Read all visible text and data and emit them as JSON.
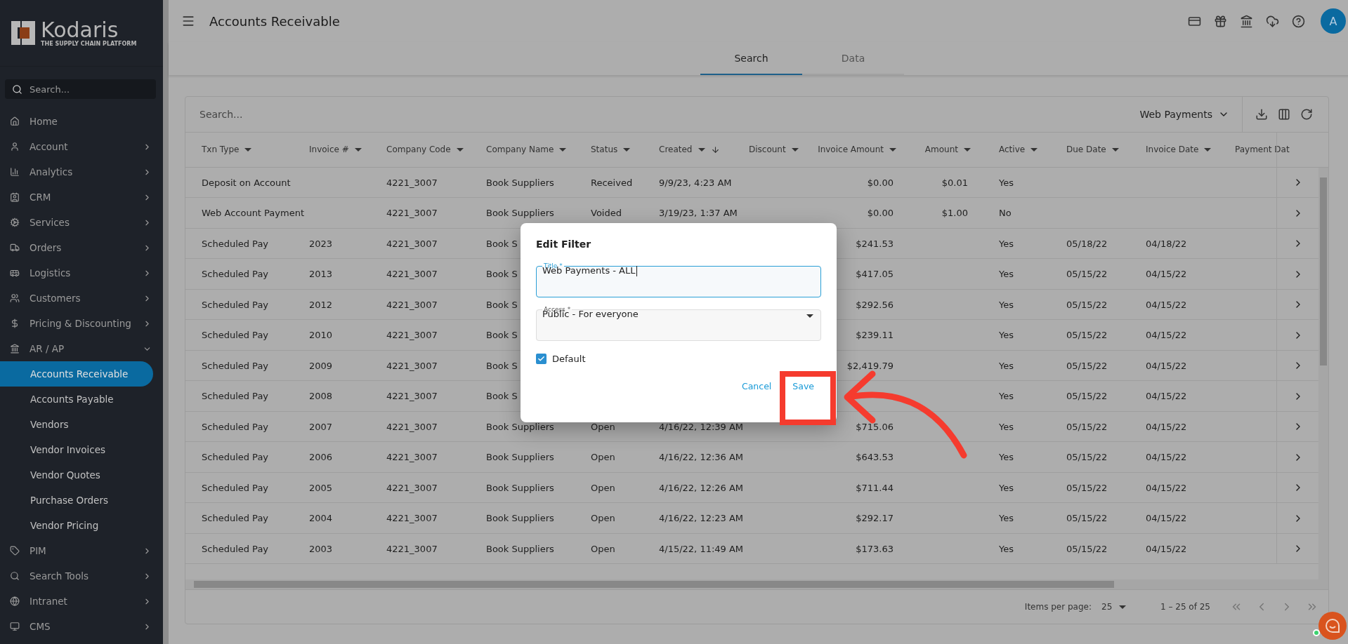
{
  "sidebar": {
    "logo": {
      "name": "Kodaris",
      "tagline": "THE SUPPLY CHAIN PLATFORM"
    },
    "search": {
      "placeholder": "Search..."
    },
    "items": [
      {
        "label": "Home"
      },
      {
        "label": "Account",
        "expanded": false
      },
      {
        "label": "Analytics",
        "expanded": false
      },
      {
        "label": "CRM",
        "expanded": false
      },
      {
        "label": "Services",
        "expanded": false
      },
      {
        "label": "Orders",
        "expanded": false
      },
      {
        "label": "Logistics",
        "expanded": false
      },
      {
        "label": "Customers",
        "expanded": false
      },
      {
        "label": "Pricing & Discounting",
        "expanded": false
      },
      {
        "label": "AR / AP",
        "expanded": true,
        "children": [
          {
            "label": "Accounts Receivable",
            "selected": true
          },
          {
            "label": "Accounts Payable",
            "selected": false
          },
          {
            "label": "Vendors",
            "selected": false
          },
          {
            "label": "Vendor Invoices",
            "selected": false
          },
          {
            "label": "Vendor Quotes",
            "selected": false
          },
          {
            "label": "Purchase Orders",
            "selected": false
          },
          {
            "label": "Vendor Pricing",
            "selected": false
          }
        ]
      },
      {
        "label": "PIM",
        "expanded": false
      },
      {
        "label": "Search Tools",
        "expanded": false
      },
      {
        "label": "Intranet",
        "expanded": false
      },
      {
        "label": "CMS",
        "expanded": false
      }
    ]
  },
  "header": {
    "title": "Accounts Receivable",
    "avatar": "A"
  },
  "tabs": [
    {
      "label": "Search",
      "selected": true
    },
    {
      "label": "Data",
      "selected": false
    }
  ],
  "table": {
    "search": {
      "placeholder": "Search..."
    },
    "filter": "Web Payments",
    "columns": [
      {
        "label": "Txn Type",
        "sorted": false
      },
      {
        "label": "Invoice #",
        "sorted": false
      },
      {
        "label": "Company Code",
        "sorted": false
      },
      {
        "label": "Company Name",
        "sorted": false
      },
      {
        "label": "Status",
        "sorted": false
      },
      {
        "label": "Created",
        "sorted": true
      },
      {
        "label": "Discount",
        "sorted": false
      },
      {
        "label": "Invoice Amount",
        "sorted": false
      },
      {
        "label": "Amount",
        "sorted": false
      },
      {
        "label": "Active",
        "sorted": false
      },
      {
        "label": "Due Date",
        "sorted": false
      },
      {
        "label": "Invoice Date",
        "sorted": false
      },
      {
        "label": "Payment Dat",
        "sorted": false
      }
    ],
    "rows": [
      [
        "Deposit on Account",
        null,
        "4221_3007",
        "Book Suppliers",
        "Received",
        "9/9/23, 4:23 AM",
        null,
        "$0.00",
        "$0.01",
        "Yes",
        null,
        null
      ],
      [
        "Web Account Payment",
        null,
        "4221_3007",
        "Book Suppliers",
        "Voided",
        "3/19/23, 1:37 AM",
        null,
        "$0.00",
        "$1.00",
        "No",
        null,
        null
      ],
      [
        "Scheduled Pay",
        "2023",
        "4221_3007",
        "Book S",
        null,
        null,
        null,
        "$241.53",
        null,
        "Yes",
        "05/18/22",
        "04/18/22"
      ],
      [
        "Scheduled Pay",
        "2013",
        "4221_3007",
        "Book S",
        null,
        null,
        null,
        "$417.05",
        null,
        "Yes",
        "05/15/22",
        "04/15/22"
      ],
      [
        "Scheduled Pay",
        "2012",
        "4221_3007",
        "Book S",
        null,
        null,
        null,
        "$292.56",
        null,
        "Yes",
        "05/15/22",
        "04/15/22"
      ],
      [
        "Scheduled Pay",
        "2010",
        "4221_3007",
        "Book S",
        null,
        null,
        null,
        "$239.11",
        null,
        "Yes",
        "05/15/22",
        "04/15/22"
      ],
      [
        "Scheduled Pay",
        "2009",
        "4221_3007",
        "Book S",
        null,
        null,
        null,
        "$2,419.79",
        null,
        "Yes",
        "05/15/22",
        "04/15/22"
      ],
      [
        "Scheduled Pay",
        "2008",
        "4221_3007",
        "Book S",
        null,
        null,
        null,
        null,
        null,
        "Yes",
        "05/15/22",
        "04/15/22"
      ],
      [
        "Scheduled Pay",
        "2007",
        "4221_3007",
        "Book Suppliers",
        "Open",
        "4/16/22, 12:39 AM",
        null,
        "$715.06",
        null,
        "Yes",
        "05/15/22",
        "04/15/22"
      ],
      [
        "Scheduled Pay",
        "2006",
        "4221_3007",
        "Book Suppliers",
        "Open",
        "4/16/22, 12:36 AM",
        null,
        "$643.53",
        null,
        "Yes",
        "05/15/22",
        "04/15/22"
      ],
      [
        "Scheduled Pay",
        "2005",
        "4221_3007",
        "Book Suppliers",
        "Open",
        "4/16/22, 12:26 AM",
        null,
        "$711.44",
        null,
        "Yes",
        "05/15/22",
        "04/15/22"
      ],
      [
        "Scheduled Pay",
        "2004",
        "4221_3007",
        "Book Suppliers",
        "Open",
        "4/16/22, 12:23 AM",
        null,
        "$292.17",
        null,
        "Yes",
        "05/15/22",
        "04/15/22"
      ],
      [
        "Scheduled Pay",
        "2003",
        "4221_3007",
        "Book Suppliers",
        "Open",
        "4/15/22, 11:49 AM",
        null,
        "$173.63",
        null,
        "Yes",
        "05/15/22",
        "04/15/22"
      ]
    ],
    "footer": {
      "items_per_page_label": "Items per page:",
      "page_size": "25",
      "range": "1 – 25 of 25"
    }
  },
  "dialog": {
    "title": "Edit Filter",
    "fields": [
      {
        "kind": "text",
        "label": "Title *",
        "value": "Web Payments - ALL",
        "focused": true
      },
      {
        "kind": "select",
        "label": "Access *",
        "value": "Public - For everyone",
        "focused": false
      }
    ],
    "default": {
      "label": "Default",
      "checked": true
    },
    "buttons": [
      "Cancel",
      "Save"
    ]
  }
}
